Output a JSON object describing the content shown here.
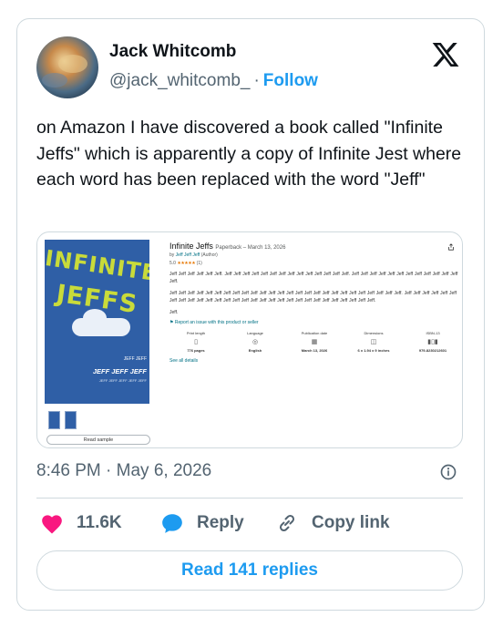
{
  "user": {
    "name": "Jack Whitcomb",
    "handle": "@jack_whitcomb_",
    "separator": "·",
    "follow_label": "Follow"
  },
  "tweet": {
    "text": "on Amazon I have discovered a book called \"Infinite Jeffs\" which is apparently a copy of Infinite Jest where each word has been replaced with the word \"Jeff\"",
    "timestamp": "8:46 PM · May 6, 2026"
  },
  "media": {
    "cover": {
      "title_line1": "INFINITE",
      "title_line2": "JEFFS",
      "author_small": "JEFF JEFF",
      "author_big": "JEFF JEFF JEFF",
      "tagline": "JEFF JEFF JEFF JEFF JEFF"
    },
    "read_sample": "Read sample",
    "title": "Infinite Jeffs",
    "format": "Paperback – March 13, 2026",
    "by_prefix": "by",
    "author": "Jeff Jeff Jeff",
    "author_role": "(Author)",
    "rating_value": "5.0",
    "stars": "★★★★★",
    "rating_count": "(1)",
    "desc1": "Jeff Jeff Jeff Jeff Jeff Jeff. Jeff Jeff Jeff Jeff Jeff Jeff Jeff Jeff Jeff Jeff Jeff Jeff Jeff Jeff. Jeff Jeff Jeff Jeff Jeff Jeff Jeff Jeff Jeff Jeff Jeff Jeff Jeff.",
    "desc2": "Jeff Jeff Jeff Jeff Jeff Jeff Jeff Jeff Jeff Jeff Jeff Jeff Jeff Jeff Jeff Jeff Jeff Jeff Jeff Jeff Jeff Jeff Jeff Jeff Jeff Jeff. Jeff Jeff Jeff Jeff Jeff Jeff Jeff Jeff Jeff Jeff Jeff Jeff Jeff Jeff Jeff Jeff Jeff Jeff Jeff Jeff Jeff Jeff Jeff Jeff Jeff Jeff Jeff Jeff Jeff.",
    "desc3": "Jeff.",
    "report": "Report an issue with this product or seller",
    "specs": [
      {
        "label": "Print length",
        "icon": "book-icon",
        "value": "776 pages"
      },
      {
        "label": "Language",
        "icon": "globe-icon",
        "value": "English"
      },
      {
        "label": "Publication date",
        "icon": "calendar-icon",
        "value": "March 13, 2026"
      },
      {
        "label": "Dimensions",
        "icon": "dimensions-icon",
        "value": "6 x 1.94 x 9 inches"
      },
      {
        "label": "ISBN-13",
        "icon": "barcode-icon",
        "value": "979-8230212601"
      }
    ],
    "see_all": "See all details"
  },
  "actions": {
    "likes": "11.6K",
    "reply_label": "Reply",
    "copy_label": "Copy link",
    "read_replies": "Read 141 replies"
  },
  "colors": {
    "accent": "#1d9bf0",
    "like": "#f91880",
    "secondary_text": "#536471",
    "border": "#cfd9de"
  }
}
